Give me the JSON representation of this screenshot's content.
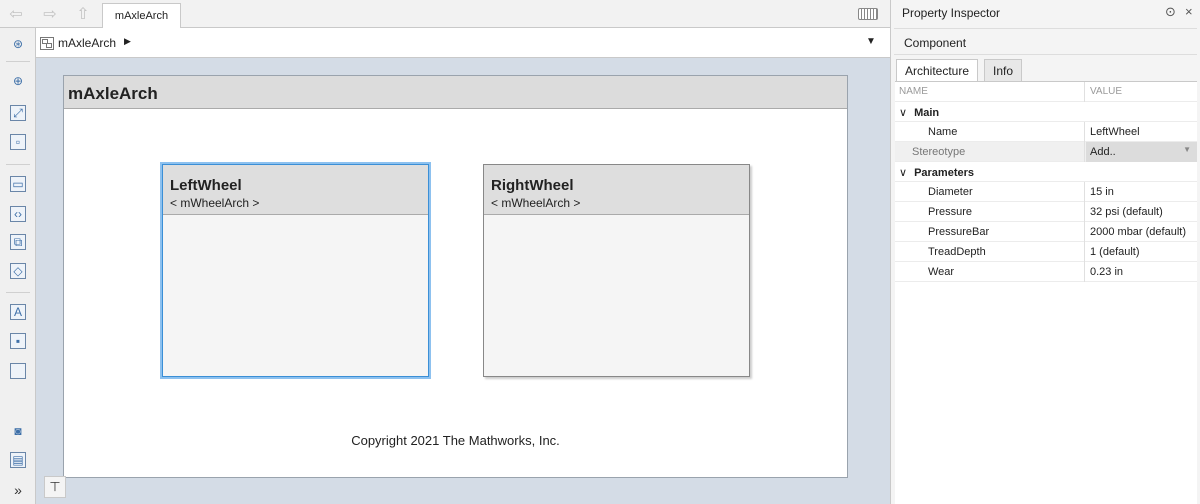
{
  "topbar": {
    "tab_label": "mAxleArch"
  },
  "address_bar": {
    "breadcrumb": "mAxleArch"
  },
  "canvas": {
    "model_title": "mAxleArch",
    "components": [
      {
        "name": "LeftWheel",
        "type": "< mWheelArch >"
      },
      {
        "name": "RightWheel",
        "type": "< mWheelArch >"
      }
    ],
    "copyright": "Copyright 2021 The Mathworks, Inc."
  },
  "property_inspector": {
    "title": "Property Inspector",
    "section": "Component",
    "tabs": [
      "Architecture",
      "Info"
    ],
    "columns": {
      "name": "NAME",
      "value": "VALUE"
    },
    "groups": {
      "main": "Main",
      "parameters": "Parameters"
    },
    "main_rows": {
      "name_label": "Name",
      "name_value": "LeftWheel",
      "stereotype_label": "Stereotype",
      "stereotype_value": "Add.."
    },
    "parameters": [
      {
        "name": "Diameter",
        "value": "15 in"
      },
      {
        "name": "Pressure",
        "value": "32 psi (default)"
      },
      {
        "name": "PressureBar",
        "value": "2000 mbar (default)"
      },
      {
        "name": "TreadDepth",
        "value": "1 (default)"
      },
      {
        "name": "Wear",
        "value": "0.23 in"
      }
    ]
  }
}
